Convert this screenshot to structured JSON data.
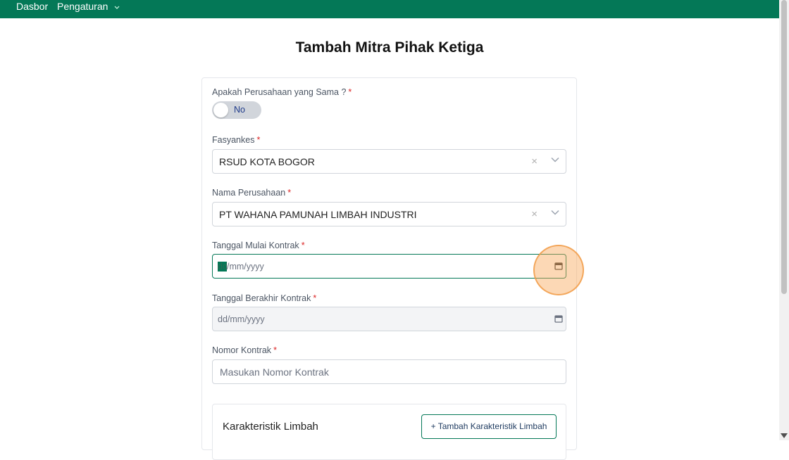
{
  "nav": {
    "dasbor": "Dasbor",
    "pengaturan": "Pengaturan"
  },
  "page": {
    "title": "Tambah Mitra Pihak Ketiga"
  },
  "form": {
    "same_company": {
      "label": "Apakah Perusahaan yang Sama ?",
      "required": "*",
      "toggle_text": "No"
    },
    "fasyankes": {
      "label": "Fasyankes",
      "required": "*",
      "value": "RSUD KOTA BOGOR",
      "clear": "×"
    },
    "company_name": {
      "label": "Nama Perusahaan",
      "required": "*",
      "value": "PT WAHANA PAMUNAH LIMBAH INDUSTRI",
      "clear": "×"
    },
    "start_date": {
      "label": "Tanggal Mulai Kontrak",
      "required": "*",
      "seg_day": "dd",
      "rest": "/mm/yyyy"
    },
    "end_date": {
      "label": "Tanggal Berakhir Kontrak",
      "required": "*",
      "placeholder": "dd/mm/yyyy"
    },
    "contract_number": {
      "label": "Nomor Kontrak",
      "required": "*",
      "placeholder": "Masukan Nomor Kontrak"
    }
  },
  "waste_section": {
    "title": "Karakteristik Limbah",
    "add_button": "+  Tambah Karakteristik Limbah"
  },
  "colors": {
    "brand": "#047857",
    "required": "#dc2626",
    "highlight": "#f9a85a"
  }
}
